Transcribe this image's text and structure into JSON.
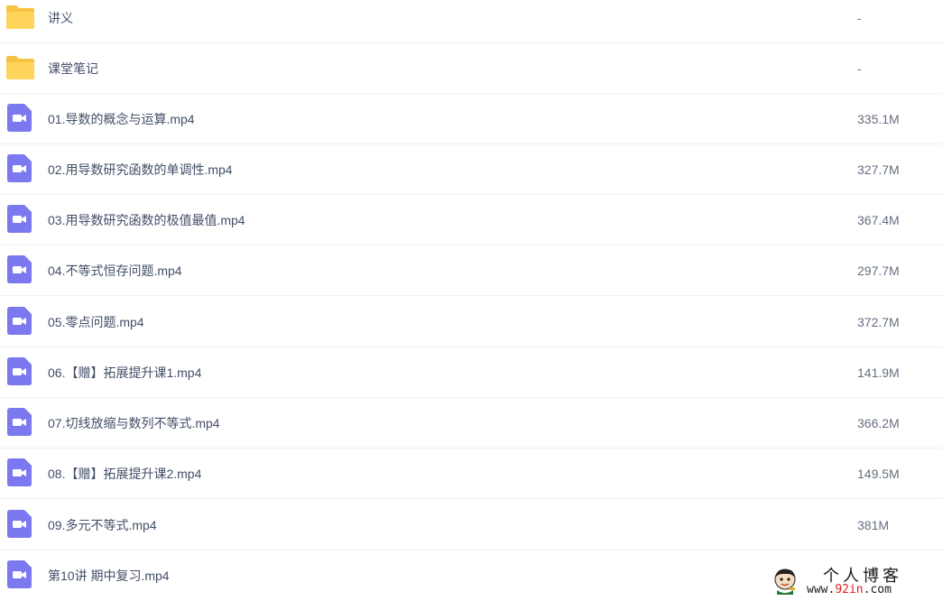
{
  "files": [
    {
      "name": "讲义",
      "size": "-",
      "type": "folder"
    },
    {
      "name": "课堂笔记",
      "size": "-",
      "type": "folder"
    },
    {
      "name": "01.导数的概念与运算.mp4",
      "size": "335.1M",
      "type": "video"
    },
    {
      "name": "02.用导数研究函数的单调性.mp4",
      "size": "327.7M",
      "type": "video"
    },
    {
      "name": "03.用导数研究函数的极值最值.mp4",
      "size": "367.4M",
      "type": "video"
    },
    {
      "name": "04.不等式恒存问题.mp4",
      "size": "297.7M",
      "type": "video"
    },
    {
      "name": "05.零点问题.mp4",
      "size": "372.7M",
      "type": "video"
    },
    {
      "name": "06.【赠】拓展提升课1.mp4",
      "size": "141.9M",
      "type": "video"
    },
    {
      "name": "07.切线放缩与数列不等式.mp4",
      "size": "366.2M",
      "type": "video"
    },
    {
      "name": "08.【赠】拓展提升课2.mp4",
      "size": "149.5M",
      "type": "video"
    },
    {
      "name": "09.多元不等式.mp4",
      "size": "381M",
      "type": "video"
    },
    {
      "name": "第10讲 期中复习.mp4",
      "size": "",
      "type": "video"
    }
  ],
  "icons": {
    "folder": "folder-icon",
    "video": "video-file-icon"
  },
  "colors": {
    "folder_yellow": "#ffd45a",
    "video_purple": "#7b78f0",
    "text": "#424e67",
    "size_text": "#666f80"
  },
  "watermark": {
    "title": "个人博客",
    "url_prefix": "www.",
    "url_accent": "92in",
    "url_suffix": ".com"
  }
}
